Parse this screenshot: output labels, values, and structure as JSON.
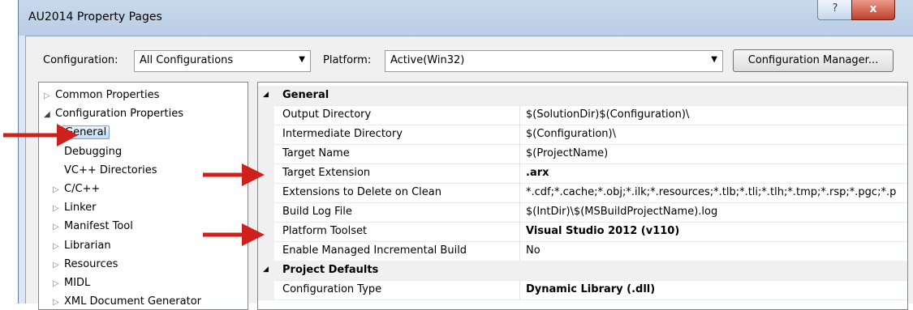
{
  "window": {
    "title": "AU2014 Property Pages",
    "help_label": "?",
    "close_label": "x"
  },
  "toolbar": {
    "configuration_label": "Configuration:",
    "configuration_value": "All Configurations",
    "platform_label": "Platform:",
    "platform_value": "Active(Win32)",
    "config_manager_label": "Configuration Manager..."
  },
  "tree": {
    "items": [
      {
        "label": "Common Properties"
      },
      {
        "label": "Configuration Properties"
      },
      {
        "label": "General"
      },
      {
        "label": "Debugging"
      },
      {
        "label": "VC++ Directories"
      },
      {
        "label": "C/C++"
      },
      {
        "label": "Linker"
      },
      {
        "label": "Manifest Tool"
      },
      {
        "label": "Librarian"
      },
      {
        "label": "Resources"
      },
      {
        "label": "MIDL"
      },
      {
        "label": "XML Document Generator"
      }
    ]
  },
  "grid": {
    "categories": {
      "general": "General",
      "project_defaults": "Project Defaults"
    },
    "rows": [
      {
        "name": "Output Directory",
        "value": "$(SolutionDir)$(Configuration)\\"
      },
      {
        "name": "Intermediate Directory",
        "value": "$(Configuration)\\"
      },
      {
        "name": "Target Name",
        "value": "$(ProjectName)"
      },
      {
        "name": "Target Extension",
        "value": ".arx"
      },
      {
        "name": "Extensions to Delete on Clean",
        "value": "*.cdf;*.cache;*.obj;*.ilk;*.resources;*.tlb;*.tli;*.tlh;*.tmp;*.rsp;*.pgc;*.p"
      },
      {
        "name": "Build Log File",
        "value": "$(IntDir)\\$(MSBuildProjectName).log"
      },
      {
        "name": "Platform Toolset",
        "value": "Visual Studio 2012 (v110)"
      },
      {
        "name": "Enable Managed Incremental Build",
        "value": "No"
      },
      {
        "name": "Configuration Type",
        "value": "Dynamic Library (.dll)"
      }
    ]
  },
  "colors": {
    "annotation_arrow": "#d0201c",
    "title_bar": "#c9d9ec",
    "selection": "#c1dcfc"
  }
}
